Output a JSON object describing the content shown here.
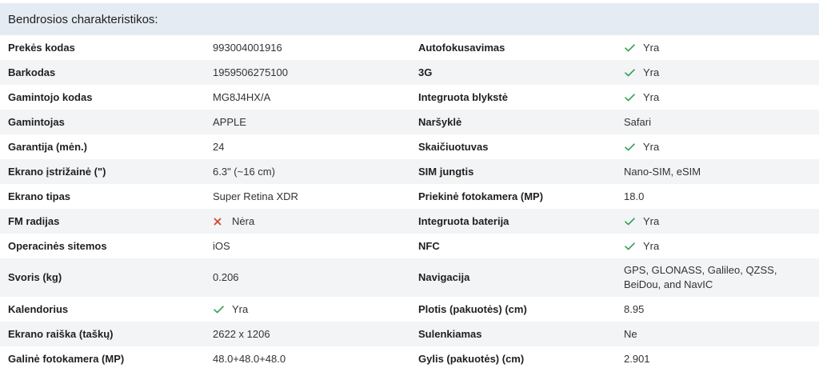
{
  "section": {
    "title": "Bendrosios charakteristikos:"
  },
  "rows": [
    {
      "left": {
        "label": "Prekės kodas",
        "value": "993004001916"
      },
      "right": {
        "label": "Autofokusavimas",
        "value": "Yra",
        "status": "yes"
      }
    },
    {
      "left": {
        "label": "Barkodas",
        "value": "1959506275100"
      },
      "right": {
        "label": "3G",
        "value": "Yra",
        "status": "yes"
      }
    },
    {
      "left": {
        "label": "Gamintojo kodas",
        "value": "MG8J4HX/A"
      },
      "right": {
        "label": "Integruota blykstė",
        "value": "Yra",
        "status": "yes"
      }
    },
    {
      "left": {
        "label": "Gamintojas",
        "value": "APPLE"
      },
      "right": {
        "label": "Naršyklė",
        "value": "Safari"
      }
    },
    {
      "left": {
        "label": "Garantija (mėn.)",
        "value": "24"
      },
      "right": {
        "label": "Skaičiuotuvas",
        "value": "Yra",
        "status": "yes"
      }
    },
    {
      "left": {
        "label": "Ekrano įstrižainė (\")",
        "value": "6.3\" (~16 cm)"
      },
      "right": {
        "label": "SIM jungtis",
        "value": "Nano-SIM, eSIM"
      }
    },
    {
      "left": {
        "label": "Ekrano tipas",
        "value": "Super Retina XDR"
      },
      "right": {
        "label": "Priekinė fotokamera (MP)",
        "value": "18.0"
      }
    },
    {
      "left": {
        "label": "FM radijas",
        "value": "Nėra",
        "status": "no"
      },
      "right": {
        "label": "Integruota baterija",
        "value": "Yra",
        "status": "yes"
      }
    },
    {
      "left": {
        "label": "Operacinės sitemos",
        "value": "iOS"
      },
      "right": {
        "label": "NFC",
        "value": "Yra",
        "status": "yes"
      }
    },
    {
      "left": {
        "label": "Svoris (kg)",
        "value": "0.206"
      },
      "right": {
        "label": "Navigacija",
        "value": "GPS, GLONASS, Galileo, QZSS, BeiDou, and NavIC"
      },
      "tall": true
    },
    {
      "left": {
        "label": "Kalendorius",
        "value": "Yra",
        "status": "yes"
      },
      "right": {
        "label": "Plotis (pakuotės) (cm)",
        "value": "8.95"
      }
    },
    {
      "left": {
        "label": "Ekrano raiška (taškų)",
        "value": "2622 x 1206"
      },
      "right": {
        "label": "Sulenkiamas",
        "value": "Ne"
      }
    },
    {
      "left": {
        "label": "Galinė fotokamera (MP)",
        "value": "48.0+48.0+48.0"
      },
      "right": {
        "label": "Gylis (pakuotės) (cm)",
        "value": "2.901"
      }
    }
  ],
  "icons": {
    "yes": "check-icon",
    "no": "cross-icon"
  },
  "colors": {
    "header_bg": "#e4ebf2",
    "row_shade": "#f2f4f6",
    "check": "#2e9e4f",
    "cross": "#d9462b"
  }
}
